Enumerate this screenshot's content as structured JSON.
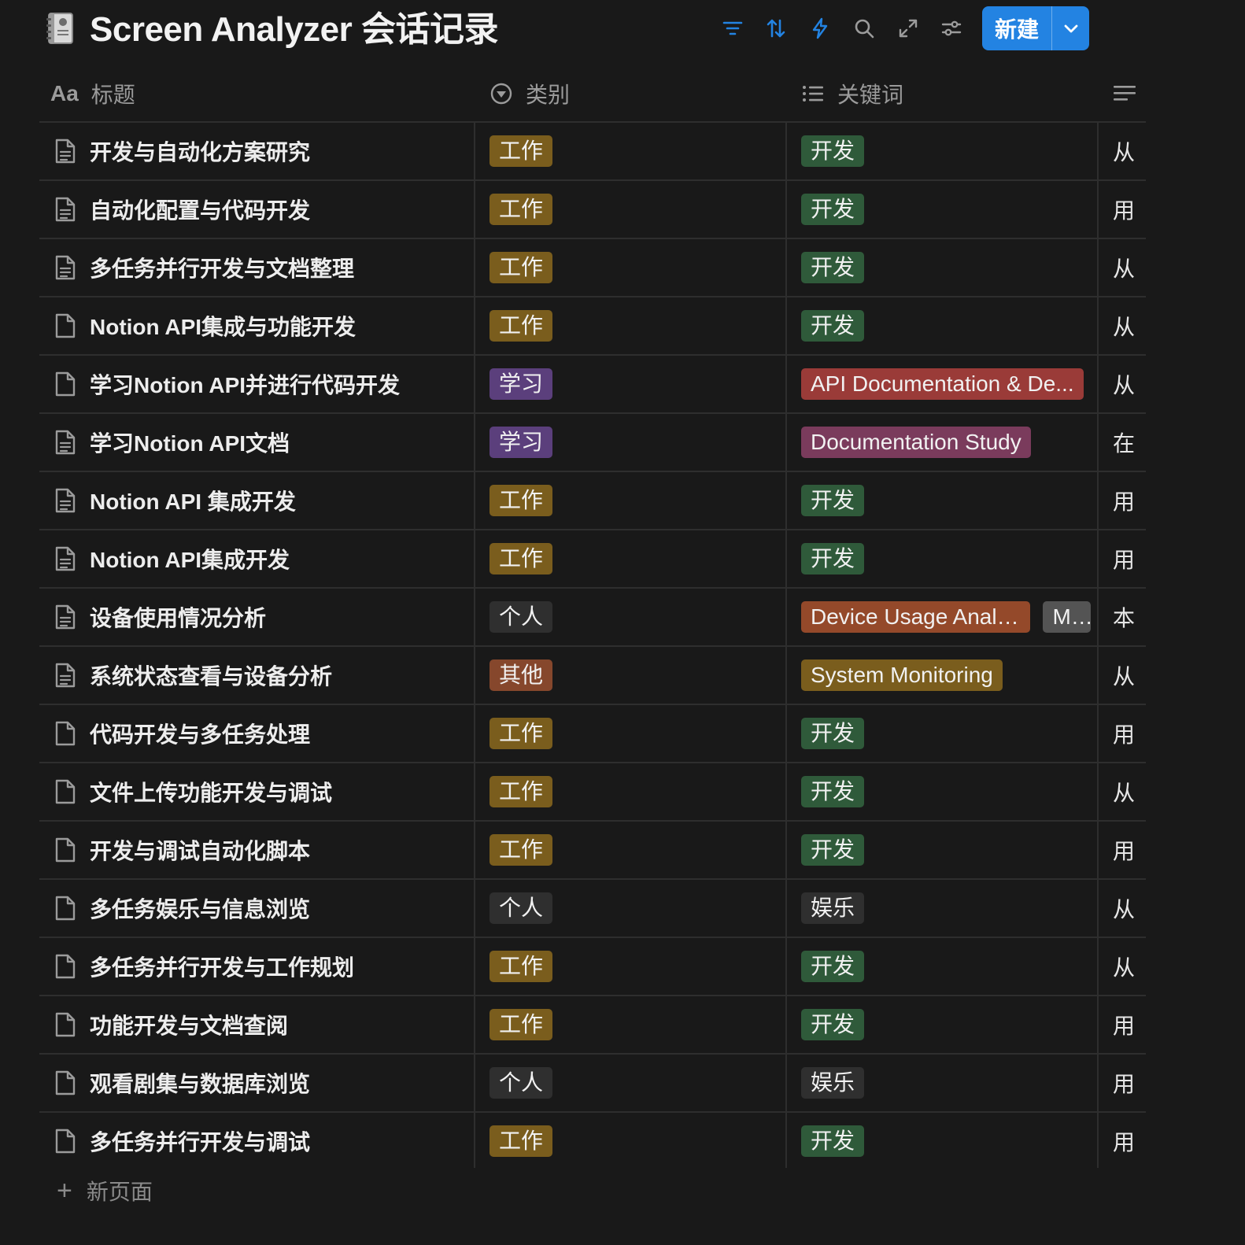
{
  "header": {
    "title": "Screen Analyzer 会话记录",
    "new_button_label": "新建",
    "icons": [
      "filter-icon",
      "sort-icon",
      "automation-icon",
      "search-icon",
      "expand-icon",
      "settings-icon",
      "chevron-down-icon"
    ],
    "accent_color": "#2383e2"
  },
  "columns": {
    "title": "标题",
    "title_icon_text": "Aa",
    "category": "类别",
    "keywords": "关键词"
  },
  "rows": [
    {
      "title": "开发与自动化方案研究",
      "icon": "page-text-icon",
      "category": "工作",
      "keywords": [
        "开发"
      ],
      "desc": "从"
    },
    {
      "title": "自动化配置与代码开发",
      "icon": "page-text-icon",
      "category": "工作",
      "keywords": [
        "开发"
      ],
      "desc": "用"
    },
    {
      "title": "多任务并行开发与文档整理",
      "icon": "page-text-icon",
      "category": "工作",
      "keywords": [
        "开发"
      ],
      "desc": "从"
    },
    {
      "title": "Notion API集成与功能开发",
      "icon": "page-icon",
      "category": "工作",
      "keywords": [
        "开发"
      ],
      "desc": "从"
    },
    {
      "title": "学习Notion API并进行代码开发",
      "icon": "page-icon",
      "category": "学习",
      "keywords": [
        "API Documentation & De..."
      ],
      "desc": "从"
    },
    {
      "title": "学习Notion API文档",
      "icon": "page-text-icon",
      "category": "学习",
      "keywords": [
        "Documentation Study"
      ],
      "desc": "在"
    },
    {
      "title": "Notion API 集成开发",
      "icon": "page-text-icon",
      "category": "工作",
      "keywords": [
        "开发"
      ],
      "desc": "用"
    },
    {
      "title": "Notion API集成开发",
      "icon": "page-text-icon",
      "category": "工作",
      "keywords": [
        "开发"
      ],
      "desc": "用"
    },
    {
      "title": "设备使用情况分析",
      "icon": "page-text-icon",
      "category": "个人",
      "keywords": [
        "Device Usage Analysis",
        "Mu"
      ],
      "desc": "本"
    },
    {
      "title": "系统状态查看与设备分析",
      "icon": "page-text-icon",
      "category": "其他",
      "keywords": [
        "System Monitoring"
      ],
      "desc": "从"
    },
    {
      "title": "代码开发与多任务处理",
      "icon": "page-icon",
      "category": "工作",
      "keywords": [
        "开发"
      ],
      "desc": "用"
    },
    {
      "title": "文件上传功能开发与调试",
      "icon": "page-icon",
      "category": "工作",
      "keywords": [
        "开发"
      ],
      "desc": "从"
    },
    {
      "title": "开发与调试自动化脚本",
      "icon": "page-icon",
      "category": "工作",
      "keywords": [
        "开发"
      ],
      "desc": "用"
    },
    {
      "title": "多任务娱乐与信息浏览",
      "icon": "page-icon",
      "category": "个人",
      "keywords": [
        "娱乐"
      ],
      "desc": "从"
    },
    {
      "title": "多任务并行开发与工作规划",
      "icon": "page-icon",
      "category": "工作",
      "keywords": [
        "开发"
      ],
      "desc": "从"
    },
    {
      "title": "功能开发与文档查阅",
      "icon": "page-icon",
      "category": "工作",
      "keywords": [
        "开发"
      ],
      "desc": "用"
    },
    {
      "title": "观看剧集与数据库浏览",
      "icon": "page-icon",
      "category": "个人",
      "keywords": [
        "娱乐"
      ],
      "desc": "用"
    },
    {
      "title": "多任务并行开发与调试",
      "icon": "page-icon",
      "category": "工作",
      "keywords": [
        "开发"
      ],
      "desc": "用"
    }
  ],
  "tag_colors": {
    "工作": "#7a5d1d",
    "学习": "#5b3f7c",
    "个人": "#2f2f2f",
    "其他": "#86472c",
    "开发": "#2f5a3a",
    "娱乐": "#2f2f2f",
    "API Documentation & De...": "#9a3b38",
    "Documentation Study": "#7a3b5c",
    "Device Usage Analysis": "#94492a",
    "Mu": "#545454",
    "System Monitoring": "#7a5d1d"
  },
  "footer": {
    "new_page_label": "新页面"
  }
}
